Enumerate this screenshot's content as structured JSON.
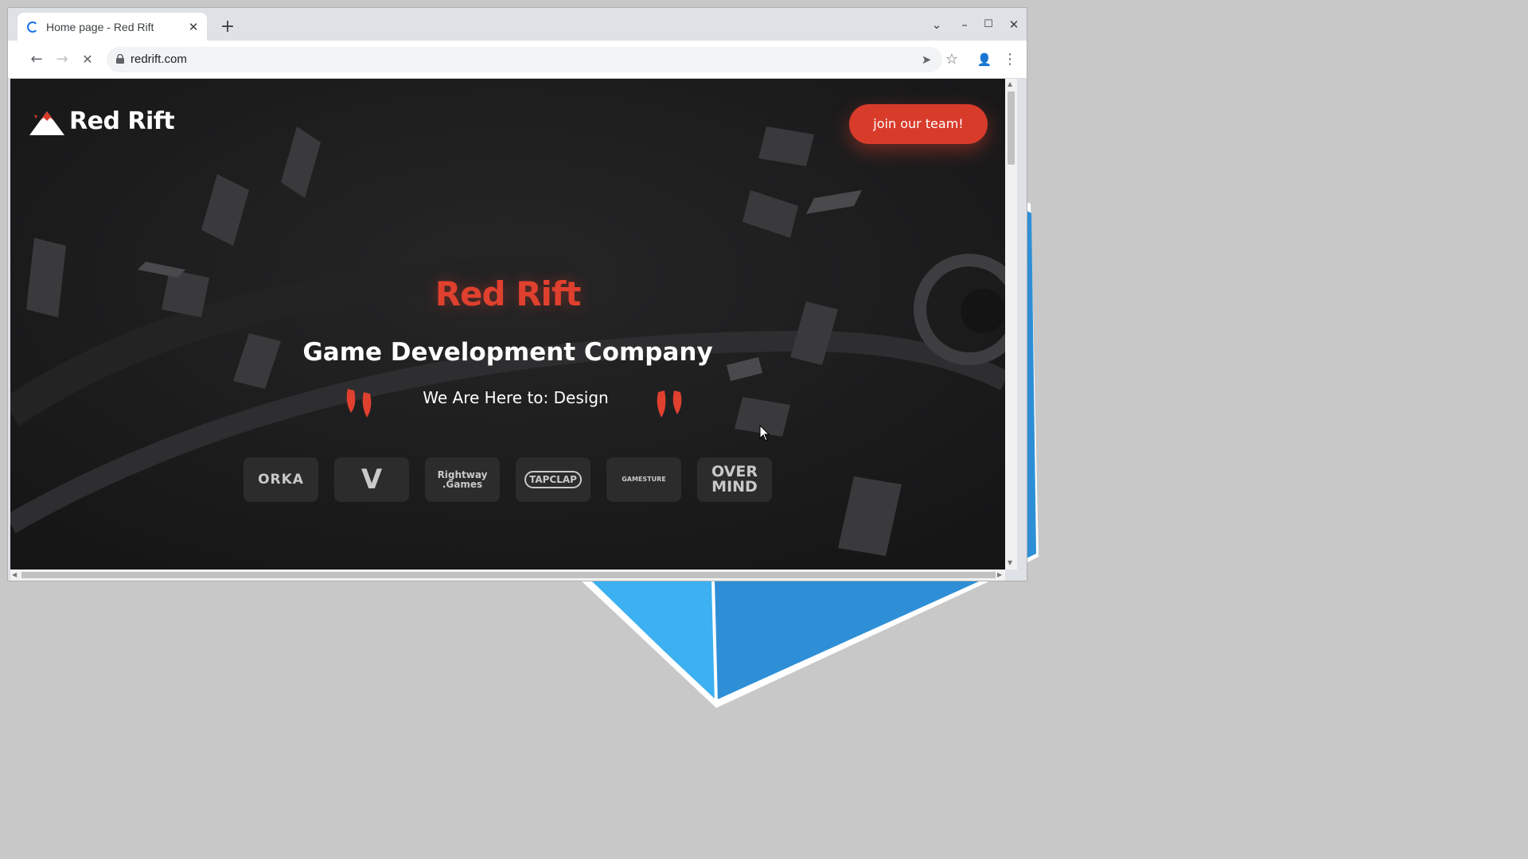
{
  "browser": {
    "tab_title": "Home page - Red Rift",
    "url": "redrift.com",
    "icons": {
      "new_tab": "plus-icon",
      "tab_close": "close-icon",
      "tab_list": "chevron-down-icon",
      "minimize": "minimize-icon",
      "maximize": "maximize-icon",
      "close": "close-icon",
      "back": "arrow-left-icon",
      "forward": "arrow-right-icon",
      "stop": "stop-icon",
      "lock": "lock-icon",
      "send": "send-icon",
      "bookmark": "star-icon",
      "profile": "profile-icon",
      "menu": "kebab-menu-icon"
    },
    "glyphs": {
      "new_tab": "+",
      "tab_close": "✕",
      "tab_list": "⌄",
      "minimize": "–",
      "maximize": "☐",
      "close": "✕",
      "back": "←",
      "forward": "→",
      "stop": "✕",
      "send": "➤",
      "bookmark": "☆",
      "profile": "👤",
      "menu": "⋮"
    }
  },
  "page": {
    "logo_text": "Red Rift",
    "cta_label": "join our team!",
    "hero_title": "Red Rift",
    "hero_subtitle": "Game Development Company",
    "hero_tagline": "We Are Here to: Design",
    "partners": [
      {
        "name": "orka",
        "text": "ORKA"
      },
      {
        "name": "v-logo",
        "text": "V"
      },
      {
        "name": "rightway-games",
        "text": "Rightway\n.Games"
      },
      {
        "name": "tapclap",
        "text": "TAPCLAP"
      },
      {
        "name": "gamesture",
        "text": "GAMESTURE"
      },
      {
        "name": "overmind",
        "text": "OVER\nMIND"
      }
    ]
  },
  "colors": {
    "accent": "#d93b2b",
    "hero_title": "#e0402e",
    "page_bg": "#1b1b1c",
    "desktop_bg": "#c8c8c8",
    "desktop_shape": "#3aa8e8"
  }
}
